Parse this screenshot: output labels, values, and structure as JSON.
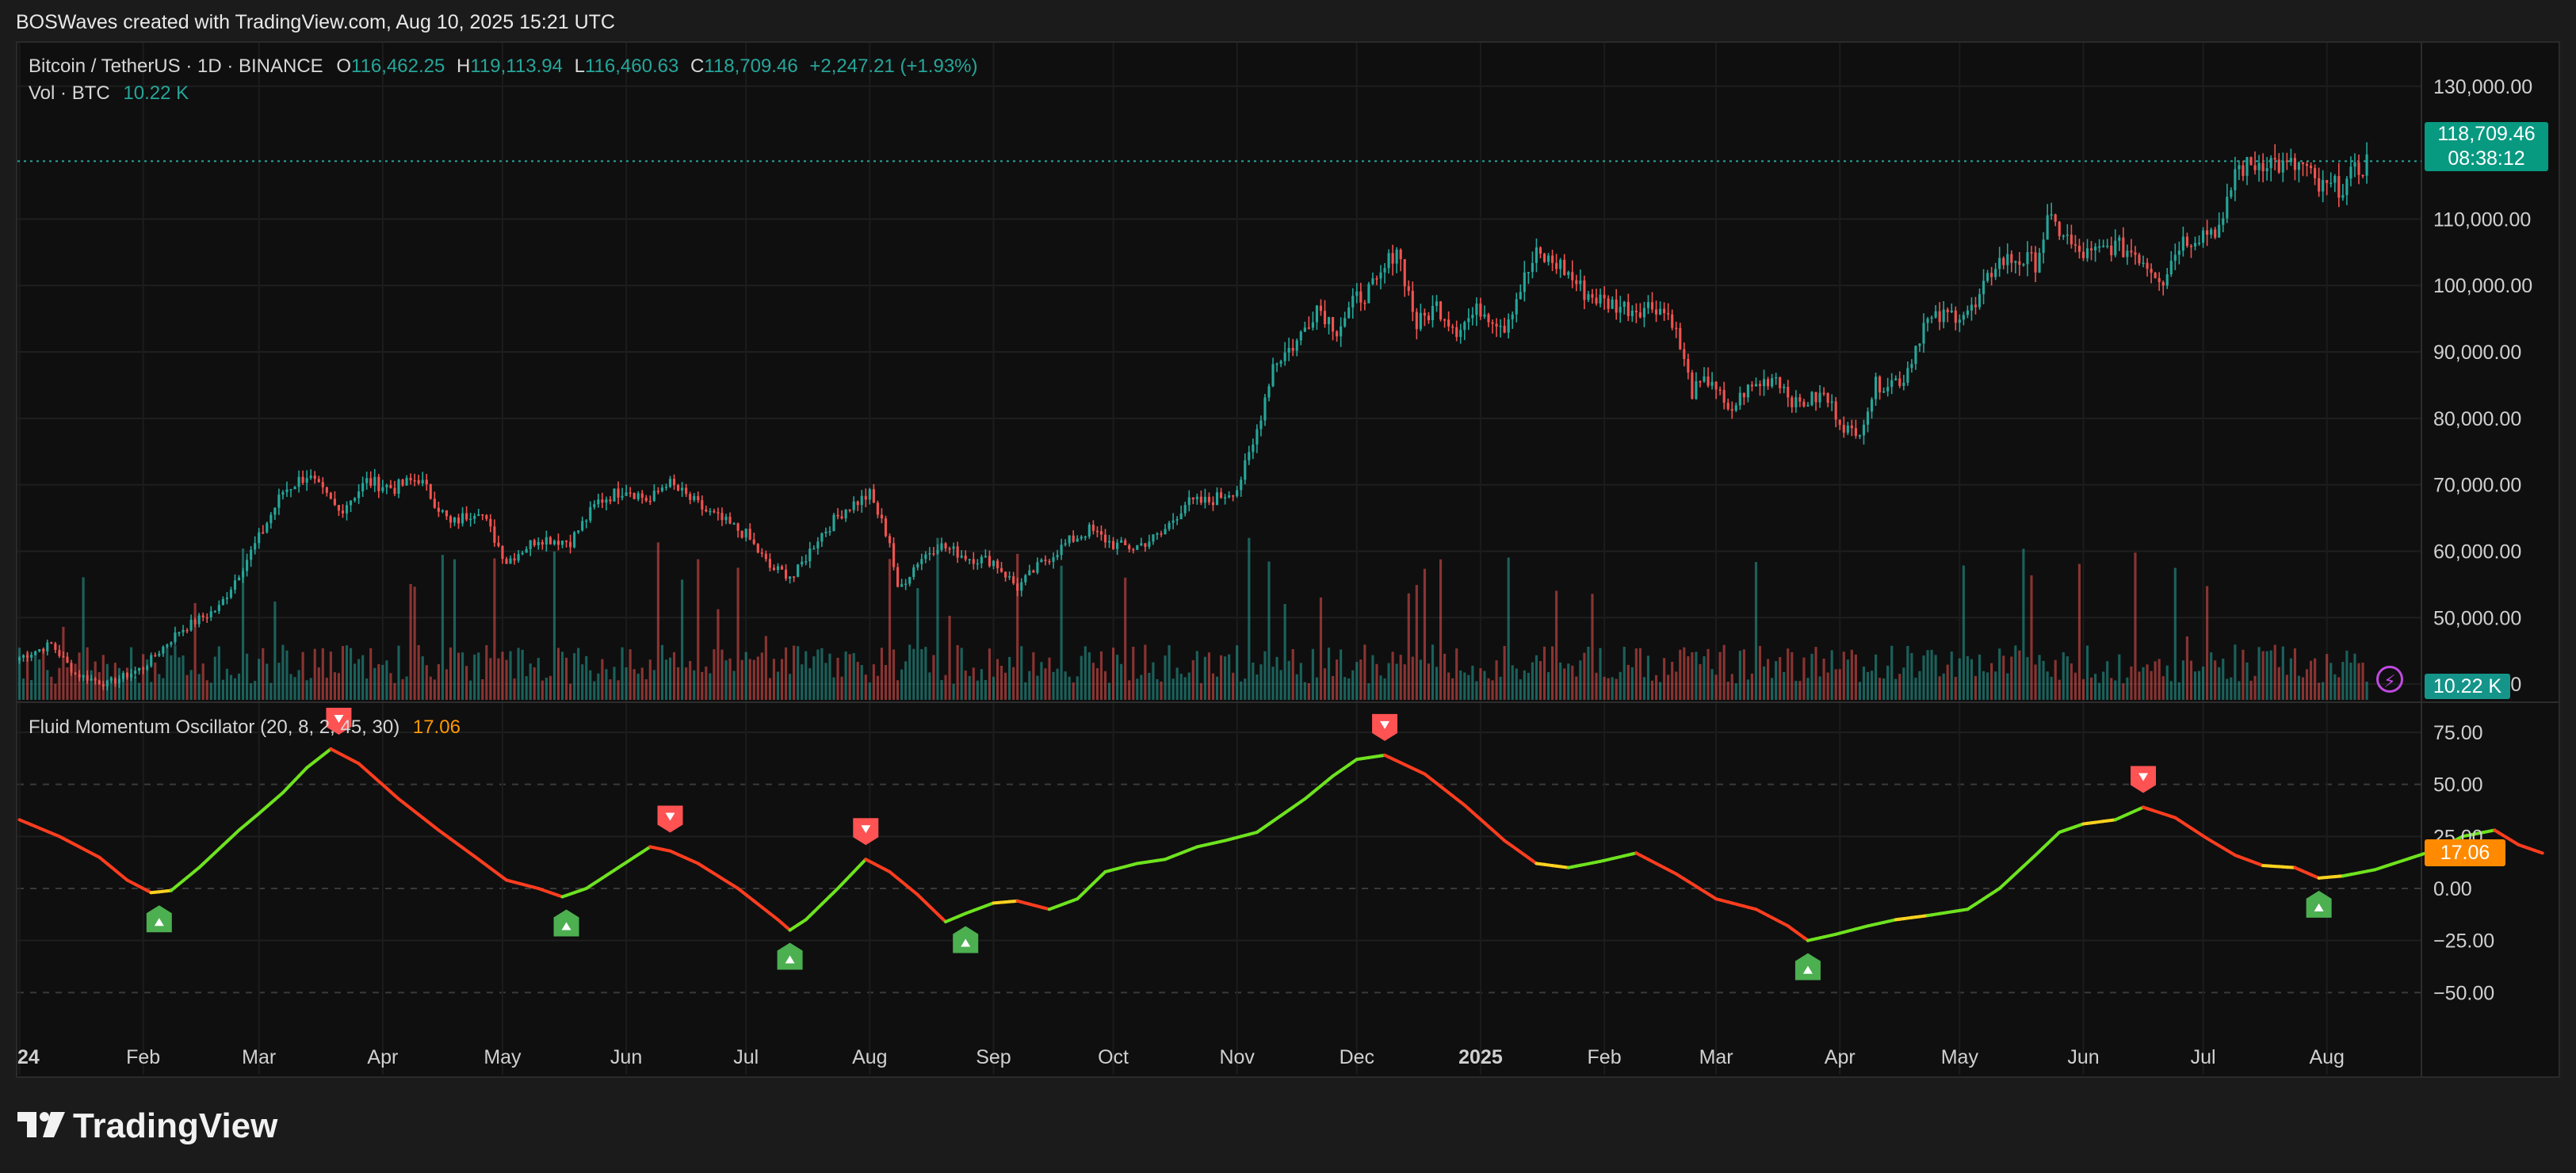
{
  "topbar": {
    "text": "BOSWaves created with TradingView.com, Aug 10, 2025 15:21 UTC"
  },
  "legend": {
    "symbol": "Bitcoin / TetherUS · 1D · BINANCE",
    "o_label": "O",
    "o_value": "116,462.25",
    "h_label": "H",
    "h_value": "119,113.94",
    "l_label": "L",
    "l_value": "116,460.63",
    "c_label": "C",
    "c_value": "118,709.46",
    "change": "+2,247.21 (+1.93%)",
    "vol_label": "Vol · BTC",
    "vol_value": "10.22 K",
    "osc_label": "Fluid Momentum Oscillator (20, 8, 2, 45, 30)",
    "osc_value": "17.06"
  },
  "tags": {
    "price": "118,709.46",
    "countdown": "08:38:12",
    "volume": "10.22 K",
    "osc": "17.06"
  },
  "brand": {
    "name": "TradingView"
  },
  "colors": {
    "up": "#26a69a",
    "down": "#ef5350",
    "osc_bull": "#6ee31f",
    "osc_bear": "#ff3d1f",
    "osc_mid": "#ffd21f",
    "signal_up": "#4caf50",
    "signal_down": "#ff5252"
  },
  "icons": {
    "replay": "bolt-icon",
    "signal_up": "triangle-up-icon",
    "signal_down": "triangle-down-icon"
  },
  "chart_data": [
    {
      "type": "candlestick",
      "title": "Bitcoin / TetherUS · 1D · BINANCE",
      "ylim": [
        35000,
        132000
      ],
      "y_ticks": [
        40000,
        50000,
        60000,
        70000,
        80000,
        90000,
        100000,
        110000,
        130000
      ],
      "y_tick_labels": [
        "40,000.00",
        "50,000.00",
        "60,000.00",
        "70,000.00",
        "80,000.00",
        "90,000.00",
        "100,000.00",
        "110,000.00",
        "130,000.00"
      ],
      "x_labels": [
        "24",
        "Feb",
        "Mar",
        "Apr",
        "May",
        "Jun",
        "Jul",
        "Aug",
        "Sep",
        "Oct",
        "Nov",
        "Dec",
        "2025",
        "Feb",
        "Mar",
        "Apr",
        "May",
        "Jun",
        "Jul",
        "Aug"
      ],
      "x_label_index": [
        0,
        31,
        60,
        91,
        121,
        152,
        182,
        213,
        244,
        274,
        305,
        335,
        366,
        397,
        425,
        456,
        486,
        517,
        547,
        578
      ],
      "start_date": "2024-01-01",
      "close_anchors": [
        [
          0,
          44000
        ],
        [
          8,
          46000
        ],
        [
          14,
          41500
        ],
        [
          22,
          40000
        ],
        [
          31,
          42500
        ],
        [
          40,
          48000
        ],
        [
          50,
          51500
        ],
        [
          60,
          62000
        ],
        [
          66,
          69000
        ],
        [
          72,
          71500
        ],
        [
          80,
          66000
        ],
        [
          87,
          70500
        ],
        [
          94,
          69500
        ],
        [
          100,
          71000
        ],
        [
          108,
          64000
        ],
        [
          115,
          66500
        ],
        [
          122,
          58500
        ],
        [
          130,
          62000
        ],
        [
          138,
          61500
        ],
        [
          145,
          67500
        ],
        [
          152,
          69500
        ],
        [
          158,
          67500
        ],
        [
          162,
          70500
        ],
        [
          172,
          66000
        ],
        [
          182,
          62500
        ],
        [
          188,
          57500
        ],
        [
          194,
          56200
        ],
        [
          200,
          62000
        ],
        [
          207,
          66500
        ],
        [
          213,
          68500
        ],
        [
          218,
          61500
        ],
        [
          220,
          54000
        ],
        [
          225,
          58500
        ],
        [
          230,
          61000
        ],
        [
          238,
          59000
        ],
        [
          244,
          58500
        ],
        [
          250,
          54500
        ],
        [
          256,
          58200
        ],
        [
          263,
          61500
        ],
        [
          268,
          63200
        ],
        [
          274,
          61000
        ],
        [
          279,
          60500
        ],
        [
          286,
          62500
        ],
        [
          292,
          67200
        ],
        [
          298,
          67500
        ],
        [
          305,
          69500
        ],
        [
          309,
          75800
        ],
        [
          314,
          88200
        ],
        [
          320,
          91500
        ],
        [
          325,
          97000
        ],
        [
          330,
          93500
        ],
        [
          335,
          98000
        ],
        [
          340,
          100000
        ],
        [
          345,
          106000
        ],
        [
          350,
          94000
        ],
        [
          355,
          97000
        ],
        [
          360,
          93500
        ],
        [
          366,
          96500
        ],
        [
          372,
          94000
        ],
        [
          377,
          101000
        ],
        [
          380,
          104500
        ],
        [
          386,
          103000
        ],
        [
          392,
          99000
        ],
        [
          397,
          97500
        ],
        [
          404,
          96500
        ],
        [
          410,
          97000
        ],
        [
          414,
          95000
        ],
        [
          419,
          84000
        ],
        [
          424,
          86000
        ],
        [
          428,
          80500
        ],
        [
          432,
          84000
        ],
        [
          440,
          86500
        ],
        [
          445,
          82000
        ],
        [
          452,
          83500
        ],
        [
          457,
          79000
        ],
        [
          460,
          77000
        ],
        [
          465,
          85000
        ],
        [
          472,
          86000
        ],
        [
          477,
          94200
        ],
        [
          483,
          95500
        ],
        [
          490,
          96500
        ],
        [
          495,
          103500
        ],
        [
          500,
          104000
        ],
        [
          505,
          103500
        ],
        [
          508,
          109500
        ],
        [
          512,
          108000
        ],
        [
          515,
          105000
        ],
        [
          519,
          104500
        ],
        [
          524,
          106000
        ],
        [
          530,
          105000
        ],
        [
          537,
          101000
        ],
        [
          541,
          106500
        ],
        [
          547,
          108000
        ],
        [
          552,
          109000
        ],
        [
          555,
          117500
        ],
        [
          559,
          118000
        ],
        [
          563,
          119000
        ],
        [
          567,
          117800
        ],
        [
          572,
          118000
        ],
        [
          576,
          114500
        ],
        [
          582,
          115000
        ],
        [
          588,
          118709
        ]
      ],
      "volume_scale_max": 80000,
      "volume_last": 10220
    },
    {
      "type": "line",
      "title": "Fluid Momentum Oscillator (20, 8, 2, 45, 30)",
      "ylim": [
        -75,
        90
      ],
      "y_ticks": [
        -50,
        -25,
        0,
        25,
        50,
        75
      ],
      "y_tick_labels": [
        "−50.00",
        "−25.00",
        "0.00",
        "25.00",
        "50.00",
        "75.00"
      ],
      "anchors": [
        [
          0,
          33
        ],
        [
          10,
          25
        ],
        [
          20,
          15
        ],
        [
          27,
          4
        ],
        [
          33,
          -2
        ],
        [
          38,
          -1
        ],
        [
          45,
          10
        ],
        [
          55,
          28
        ],
        [
          60,
          36
        ],
        [
          66,
          46
        ],
        [
          72,
          58
        ],
        [
          78,
          67
        ],
        [
          85,
          60
        ],
        [
          95,
          43
        ],
        [
          105,
          28
        ],
        [
          115,
          14
        ],
        [
          122,
          4
        ],
        [
          130,
          0
        ],
        [
          136,
          -4
        ],
        [
          142,
          0
        ],
        [
          150,
          10
        ],
        [
          158,
          20
        ],
        [
          163,
          18
        ],
        [
          170,
          12
        ],
        [
          180,
          0
        ],
        [
          190,
          -15
        ],
        [
          193,
          -20
        ],
        [
          197,
          -15
        ],
        [
          205,
          0
        ],
        [
          212,
          14
        ],
        [
          218,
          8
        ],
        [
          225,
          -3
        ],
        [
          232,
          -16
        ],
        [
          237,
          -12
        ],
        [
          244,
          -7
        ],
        [
          250,
          -6
        ],
        [
          258,
          -10
        ],
        [
          265,
          -5
        ],
        [
          272,
          8
        ],
        [
          280,
          12
        ],
        [
          287,
          14
        ],
        [
          295,
          20
        ],
        [
          302,
          23
        ],
        [
          310,
          27
        ],
        [
          316,
          35
        ],
        [
          322,
          43
        ],
        [
          329,
          54
        ],
        [
          335,
          62
        ],
        [
          342,
          64
        ],
        [
          352,
          55
        ],
        [
          362,
          40
        ],
        [
          372,
          23
        ],
        [
          380,
          12
        ],
        [
          388,
          10
        ],
        [
          396,
          13
        ],
        [
          405,
          17
        ],
        [
          415,
          7
        ],
        [
          425,
          -5
        ],
        [
          435,
          -10
        ],
        [
          443,
          -18
        ],
        [
          448,
          -25
        ],
        [
          455,
          -22
        ],
        [
          463,
          -18
        ],
        [
          470,
          -15
        ],
        [
          478,
          -13
        ],
        [
          488,
          -10
        ],
        [
          496,
          0
        ],
        [
          505,
          16
        ],
        [
          511,
          27
        ],
        [
          517,
          31
        ],
        [
          525,
          33
        ],
        [
          532,
          39
        ],
        [
          540,
          34
        ],
        [
          548,
          24
        ],
        [
          555,
          16
        ],
        [
          562,
          11
        ],
        [
          570,
          10
        ],
        [
          576,
          5
        ],
        [
          582,
          6
        ],
        [
          590,
          9
        ],
        [
          598,
          14
        ],
        [
          606,
          19
        ],
        [
          612,
          25
        ],
        [
          620,
          28
        ],
        [
          626,
          21
        ],
        [
          632,
          17
        ]
      ],
      "signals": [
        {
          "index": 35,
          "value": -2,
          "direction": "up"
        },
        {
          "index": 80,
          "value": 67,
          "direction": "down"
        },
        {
          "index": 137,
          "value": -4,
          "direction": "up"
        },
        {
          "index": 163,
          "value": 20,
          "direction": "down"
        },
        {
          "index": 193,
          "value": -20,
          "direction": "up"
        },
        {
          "index": 212,
          "value": 14,
          "direction": "down"
        },
        {
          "index": 237,
          "value": -12,
          "direction": "up"
        },
        {
          "index": 342,
          "value": 64,
          "direction": "down"
        },
        {
          "index": 448,
          "value": -25,
          "direction": "up"
        },
        {
          "index": 532,
          "value": 39,
          "direction": "down"
        },
        {
          "index": 576,
          "value": 5,
          "direction": "up"
        }
      ]
    }
  ]
}
